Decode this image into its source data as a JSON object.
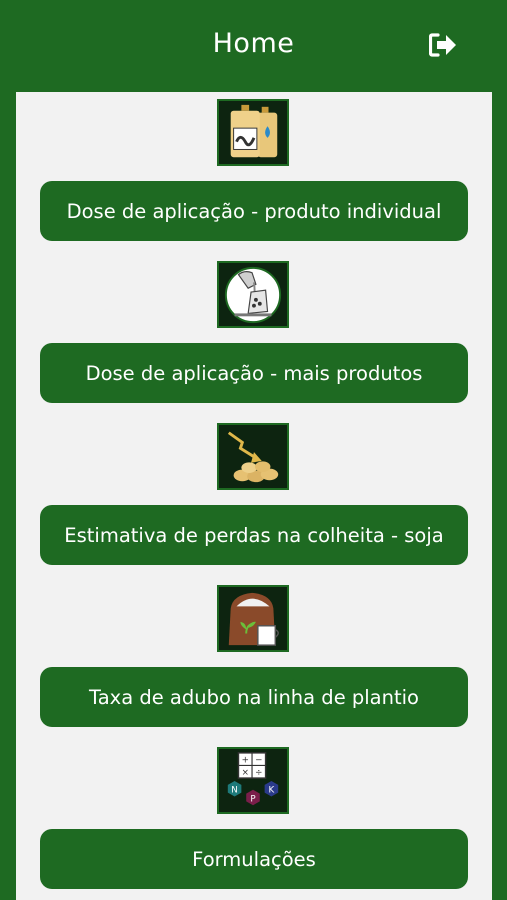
{
  "header": {
    "title": "Home",
    "logout_icon": "logout-icon"
  },
  "colors": {
    "brand_green": "#1e6a22",
    "panel_bg": "#f2f2f2",
    "thumb_bg": "#0d2410",
    "text": "#ffffff"
  },
  "menu": [
    {
      "label": "Dose de aplicação - produto individual",
      "icon": "pesticide-bottles-icon"
    },
    {
      "label": "Dose de aplicação - mais produtos",
      "icon": "pouring-mix-icon"
    },
    {
      "label": "Estimativa de perdas na colheita - soja",
      "icon": "soybean-loss-icon"
    },
    {
      "label": "Taxa de adubo na linha de plantio",
      "icon": "fertilizer-bag-icon"
    },
    {
      "label": "Formulações",
      "icon": "npk-formula-icon"
    }
  ]
}
